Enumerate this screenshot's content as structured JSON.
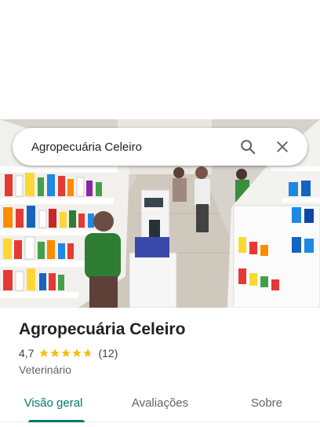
{
  "search": {
    "query": "Agropecuária Celeiro",
    "search_icon": "search-icon",
    "close_icon": "close-icon"
  },
  "place": {
    "name": "Agropecuária Celeiro",
    "rating": "4,7",
    "rating_value": 4.7,
    "reviews_count": "(12)",
    "category": "Veterinário",
    "star_color": "#fbbc04"
  },
  "tabs": [
    {
      "label": "Visão geral",
      "active": true
    },
    {
      "label": "Avaliações",
      "active": false
    },
    {
      "label": "Sobre",
      "active": false
    }
  ],
  "accent_color": "#00796b"
}
